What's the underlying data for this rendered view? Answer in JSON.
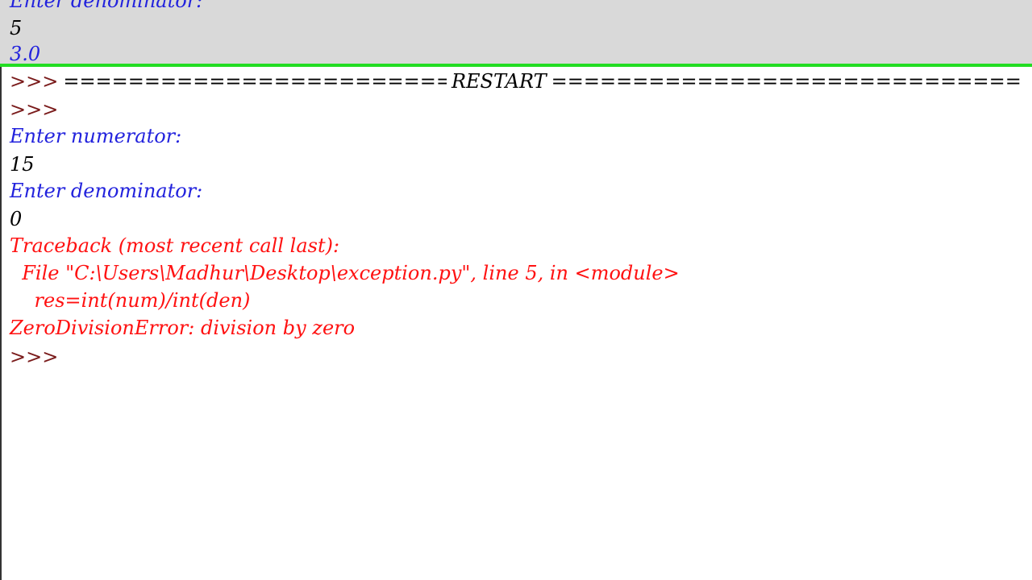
{
  "history": {
    "lines": [
      {
        "text": "Enter denominator:",
        "kind": "stdout"
      },
      {
        "text": "5",
        "kind": "stdin"
      },
      {
        "text": "3.0",
        "kind": "stdout"
      }
    ]
  },
  "shell": {
    "restart": {
      "prompt": ">>>",
      "equals_left": "===================================",
      "word": "RESTART",
      "equals_right": "==========================================="
    },
    "lines": [
      {
        "text": ">>>",
        "kind": "prompt"
      },
      {
        "text": "Enter numerator:",
        "kind": "stdout"
      },
      {
        "text": "15",
        "kind": "stdin"
      },
      {
        "text": "Enter denominator:",
        "kind": "stdout"
      },
      {
        "text": "0",
        "kind": "stdin"
      },
      {
        "text": "Traceback (most recent call last):",
        "kind": "stderr"
      },
      {
        "text": "  File \"C:\\Users\\Madhur\\Desktop\\exception.py\", line 5, in <module>",
        "kind": "stderr"
      },
      {
        "text": "    res=int(num)/int(den)",
        "kind": "stderr"
      },
      {
        "text": "ZeroDivisionError: division by zero",
        "kind": "stderr"
      },
      {
        "text": ">>>",
        "kind": "prompt"
      }
    ]
  },
  "colors": {
    "divider": "#22dd22",
    "history_bg": "#d9d9d9",
    "stdout": "#2222dd",
    "stderr": "#ff1111",
    "prompt": "#7a1b1b"
  }
}
